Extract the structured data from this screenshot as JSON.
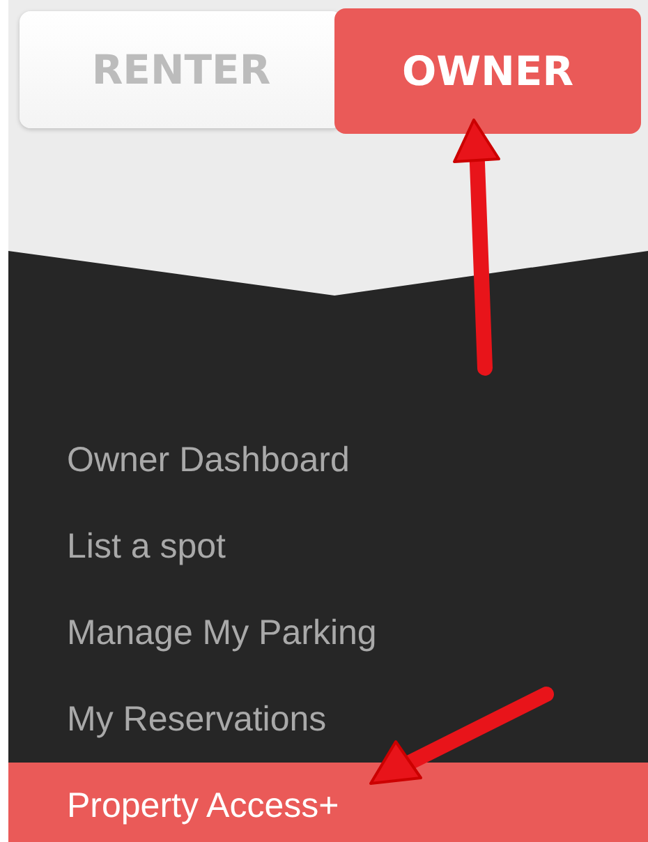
{
  "tabs": [
    {
      "label": "RENTER",
      "selected": false
    },
    {
      "label": "OWNER",
      "selected": true
    }
  ],
  "menu": {
    "items": [
      {
        "label": "Owner Dashboard",
        "selected": false
      },
      {
        "label": "List a spot",
        "selected": false
      },
      {
        "label": "Manage My Parking",
        "selected": false
      },
      {
        "label": "My Reservations",
        "selected": false
      },
      {
        "label": "Property Access+",
        "selected": true
      }
    ]
  }
}
